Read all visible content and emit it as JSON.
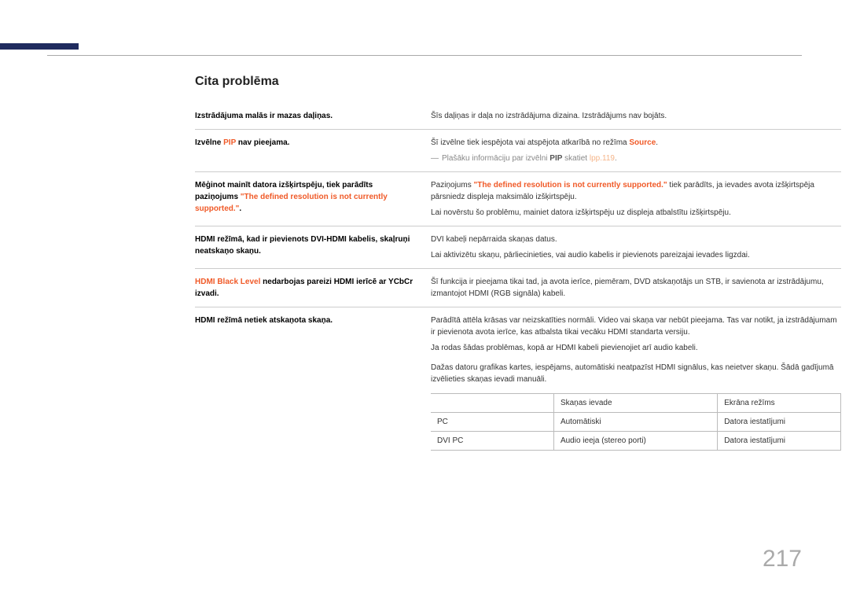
{
  "section_title": "Cita problēma",
  "page_number": "217",
  "rows": {
    "r1": {
      "left": "Izstrādājuma malās ir mazas daļiņas.",
      "right_p1": "Šīs daļiņas ir daļa no izstrādājuma dizaina. Izstrādājums nav bojāts."
    },
    "r2": {
      "left_pre": "Izvēlne ",
      "left_red": "PIP",
      "left_post": " nav pieejama.",
      "right_p1_pre": "Šī izvēlne tiek iespējota vai atspējota atkarībā no režīma ",
      "right_p1_red": "Source",
      "right_p1_post": ".",
      "note_dash": "―",
      "note_pre": "Plašāku informāciju par izvēlni ",
      "note_bold": "PIP",
      "note_mid": " skatiet ",
      "note_link": "lpp.119",
      "note_post": "."
    },
    "r3": {
      "left_p1": "Mēģinot mainīt datora izšķirtspēju, tiek parādīts paziņojums ",
      "left_red": "\"The defined resolution is not currently supported.\"",
      "left_p2": ".",
      "right_p1_pre": "Paziņojums ",
      "right_p1_red": "\"The defined resolution is not currently supported.\"",
      "right_p1_post": " tiek parādīts, ja ievades avota izšķirtspēja pārsniedz displeja maksimālo izšķirtspēju.",
      "right_p2": "Lai novērstu šo problēmu, mainiet datora izšķirtspēju uz displeja atbalstītu izšķirtspēju."
    },
    "r4": {
      "left": "HDMI režīmā, kad ir pievienots DVI-HDMI kabelis, skaļruņi neatskaņo skaņu.",
      "right_p1": "DVI kabeļi nepārraida skaņas datus.",
      "right_p2": "Lai aktivizētu skaņu, pārliecinieties, vai audio kabelis ir pievienots pareizajai ievades ligzdai."
    },
    "r5": {
      "left_red": "HDMI Black Level",
      "left_post": " nedarbojas pareizi HDMI ierīcē ar YCbCr izvadi.",
      "right_p1": "Šī funkcija ir pieejama tikai tad, ja avota ierīce, piemēram, DVD atskaņotājs un STB, ir savienota ar izstrādājumu, izmantojot HDMI (RGB signāla) kabeli."
    },
    "r6": {
      "left": "HDMI režīmā netiek atskaņota skaņa.",
      "right_p1": "Parādītā attēla krāsas var neizskatīties normāli. Video vai skaņa var nebūt pieejama. Tas var notikt, ja izstrādājumam ir pievienota avota ierīce, kas atbalsta tikai vecāku HDMI standarta versiju.",
      "right_p2": "Ja rodas šādas problēmas, kopā ar HDMI kabeli pievienojiet arī audio kabeli.",
      "right_p3": "Dažas datoru grafikas kartes, iespējams, automātiski neatpazīst HDMI signālus, kas neietver skaņu. Šādā gadījumā izvēlieties skaņas ievadi manuāli.",
      "table": {
        "h1": "",
        "h2": "Skaņas ievade",
        "h3": "Ekrāna režīms",
        "r1c1": "PC",
        "r1c2": "Automātiski",
        "r1c3": "Datora iestatījumi",
        "r2c1": "DVI PC",
        "r2c2": "Audio ieeja (stereo porti)",
        "r2c3": "Datora iestatījumi"
      }
    }
  }
}
